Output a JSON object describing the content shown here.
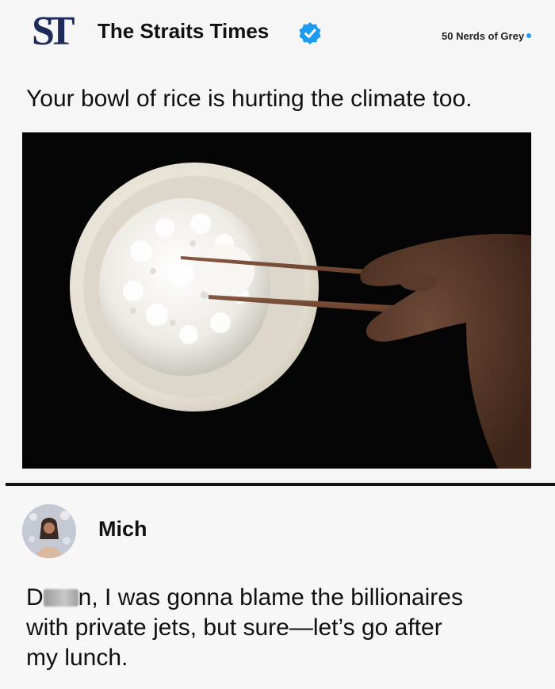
{
  "post": {
    "logo_text": "ST",
    "publisher": "The Straits Times",
    "verified_icon": "verified-badge-icon",
    "headline": "Your bowl of rice is hurting the climate too.",
    "image_alt": "bowl of white rice with chopsticks"
  },
  "watermark": {
    "text": "50 Nerds of Grey"
  },
  "reply": {
    "avatar_icon": "user-avatar-icon",
    "author": "Mich",
    "text_prefix": "D",
    "text_rest_line1": "n, I was gonna blame the billionaires",
    "text_line2": "with private jets, but sure—let’s go after",
    "text_line3": "my lunch."
  },
  "colors": {
    "brand_navy": "#1d2a5a",
    "verified_blue": "#1d9bf0",
    "photo_background": "#050505"
  }
}
